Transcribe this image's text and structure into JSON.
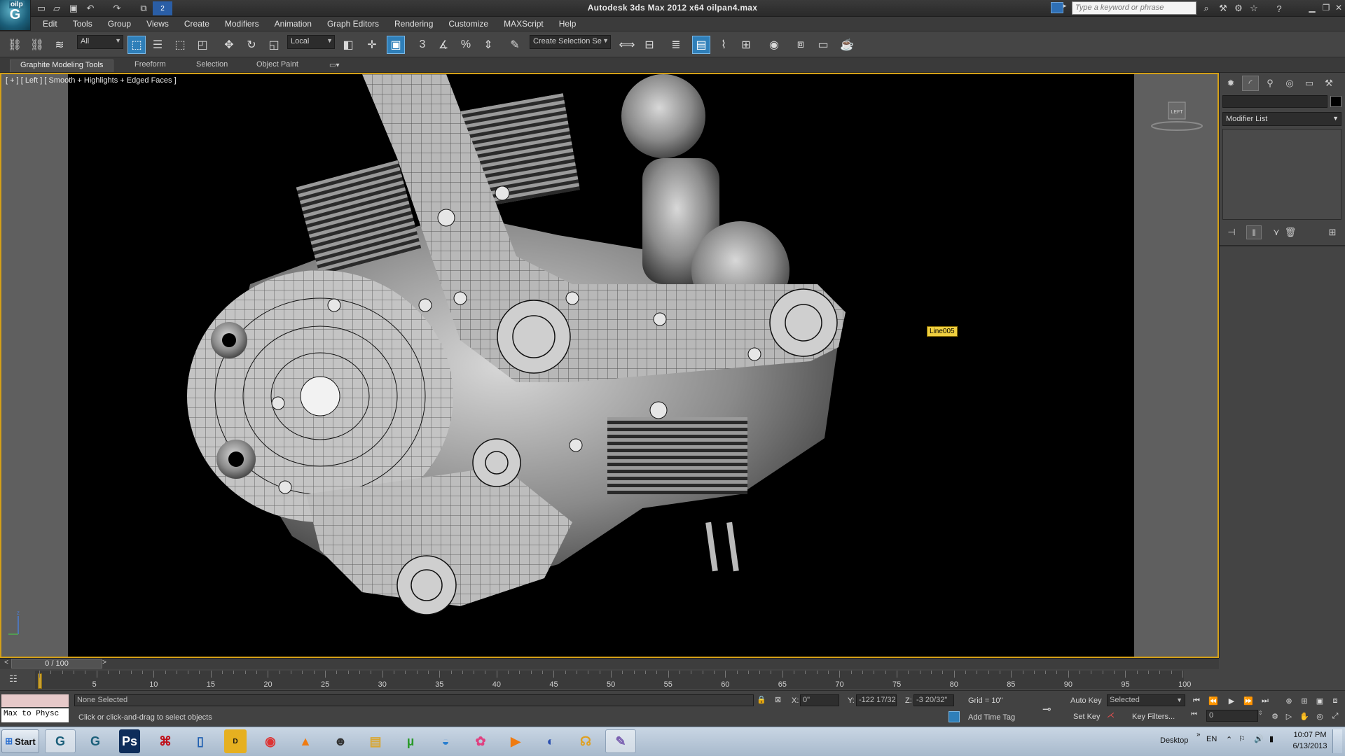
{
  "window": {
    "title": "Autodesk 3ds Max  2012 x64     oilpan4.max",
    "app_badge": "oilp",
    "search_placeholder": "Type a keyword or phrase"
  },
  "menu": [
    "Edit",
    "Tools",
    "Group",
    "Views",
    "Create",
    "Modifiers",
    "Animation",
    "Graph Editors",
    "Rendering",
    "Customize",
    "MAXScript",
    "Help"
  ],
  "toolbar": {
    "selection_filter": "All",
    "reference_coord": "Local",
    "named_selection": "Create Selection Se",
    "snap_label": "3"
  },
  "ribbon": {
    "tabs": [
      "Graphite Modeling Tools",
      "Freeform",
      "Selection",
      "Object Paint"
    ]
  },
  "viewport": {
    "label": "[ + ] [ Left ] [ Smooth + Highlights + Edged Faces ]",
    "object_tag": "Line005",
    "viewcube_face": "LEFT"
  },
  "command_panel": {
    "modifier_list": "Modifier List"
  },
  "timeline": {
    "frame_display": "0 / 100",
    "ticks": [
      "5",
      "10",
      "15",
      "20",
      "25",
      "30",
      "35",
      "40",
      "45",
      "50",
      "55",
      "60",
      "65",
      "70",
      "75",
      "80",
      "85",
      "90",
      "95",
      "100"
    ]
  },
  "status": {
    "selection_state": "None Selected",
    "prompt": "Click or click-and-drag to select objects",
    "x_value": "0\"",
    "y_value": "-122 17/32",
    "z_value": "-3 20/32\"",
    "x_label": "X:",
    "y_label": "Y:",
    "z_label": "Z:",
    "grid": "Grid = 10\"",
    "add_time_tag": "Add Time Tag",
    "auto_key": "Auto Key",
    "set_key": "Set Key",
    "key_mode": "Selected",
    "key_filters": "Key Filters...",
    "current_frame": "0",
    "maxscript_text": "Max to Physc"
  },
  "taskbar": {
    "start_label": "Start",
    "desktop_label": "Desktop",
    "language": "EN",
    "time": "10:07 PM",
    "date": "6/13/2013"
  },
  "colors": {
    "viewport_border": "#d4a017",
    "active_tool": "#2f7fb9",
    "object_tag_bg": "#f0d040"
  }
}
